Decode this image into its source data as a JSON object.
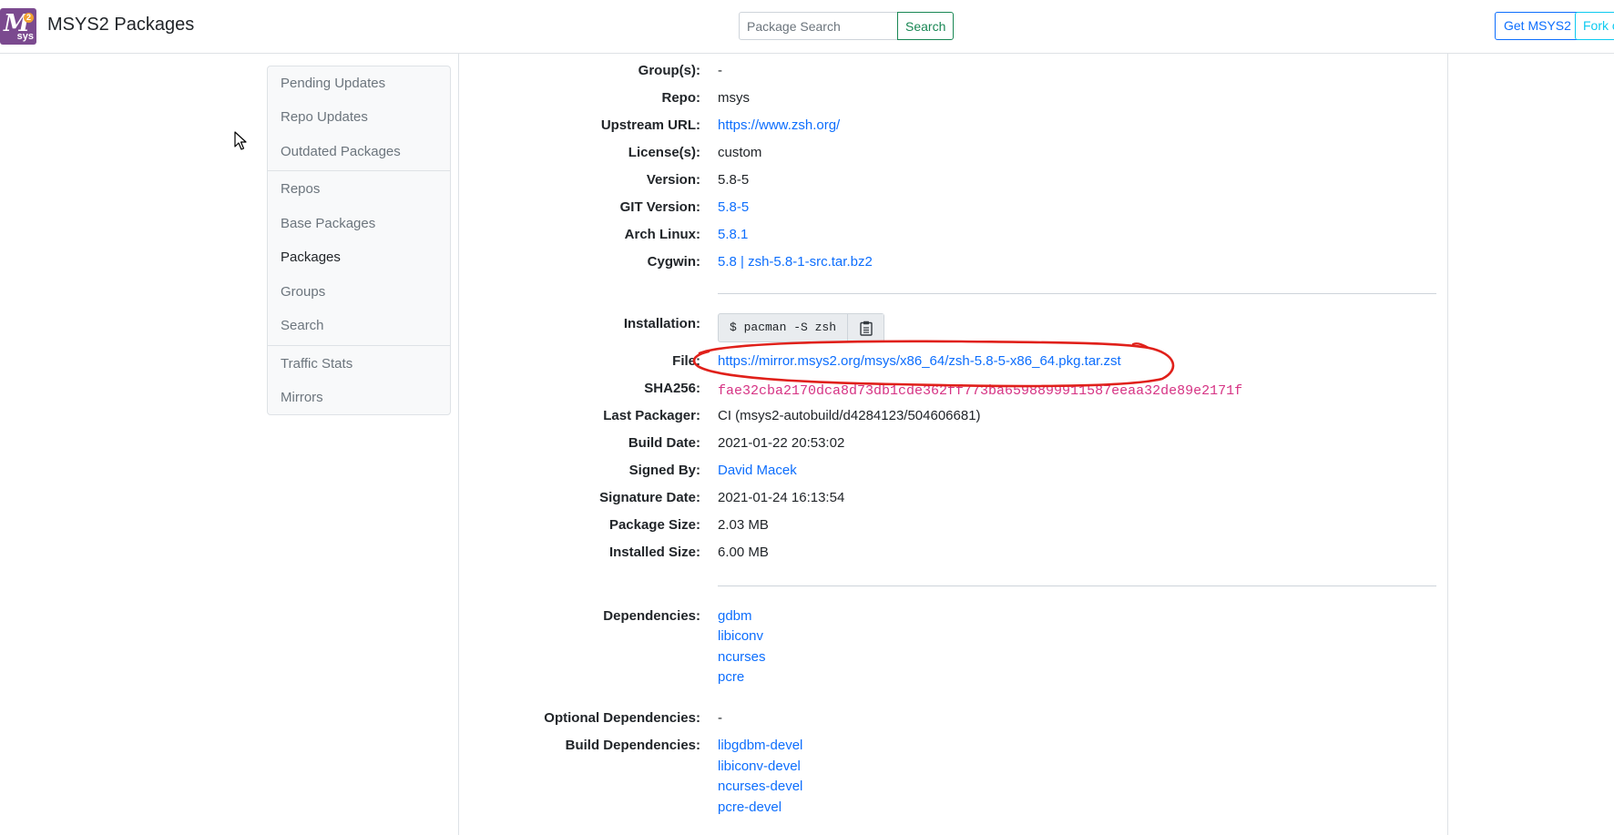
{
  "header": {
    "brand": "MSYS2 Packages",
    "logo_letter": "M",
    "logo_badge": "2",
    "logo_sub": "sys",
    "search_placeholder": "Package Search",
    "search_button": "Search",
    "get_button": "Get MSYS2",
    "fork_button": "Fork on GitHub"
  },
  "sidebar": {
    "items": [
      {
        "label": "Pending Updates"
      },
      {
        "label": "Repo Updates"
      },
      {
        "label": "Outdated Packages"
      },
      {
        "label": "Repos"
      },
      {
        "label": "Base Packages"
      },
      {
        "label": "Packages",
        "active": true
      },
      {
        "label": "Groups"
      },
      {
        "label": "Search"
      },
      {
        "label": "Traffic Stats"
      },
      {
        "label": "Mirrors"
      }
    ]
  },
  "details": {
    "groups": {
      "label": "Group(s):",
      "value": "-"
    },
    "repo": {
      "label": "Repo:",
      "value": "msys"
    },
    "upstream": {
      "label": "Upstream URL:",
      "value": "https://www.zsh.org/"
    },
    "license": {
      "label": "License(s):",
      "value": "custom"
    },
    "version": {
      "label": "Version:",
      "value": "5.8-5"
    },
    "git_version": {
      "label": "GIT Version:",
      "value": "5.8-5"
    },
    "arch": {
      "label": "Arch Linux:",
      "value": "5.8.1"
    },
    "cygwin": {
      "label": "Cygwin:",
      "value": "5.8 | zsh-5.8-1-src.tar.bz2"
    },
    "installation": {
      "label": "Installation:",
      "value": "$ pacman -S zsh"
    },
    "file": {
      "label": "File:",
      "value": "https://mirror.msys2.org/msys/x86_64/zsh-5.8-5-x86_64.pkg.tar.zst"
    },
    "sha256": {
      "label": "SHA256:",
      "value": "fae32cba2170dca8d73db1cde362ff773ba6598899911587eeaa32de89e2171f"
    },
    "packager": {
      "label": "Last Packager:",
      "value": "CI (msys2-autobuild/d4284123/504606681)"
    },
    "build_date": {
      "label": "Build Date:",
      "value": "2021-01-22 20:53:02"
    },
    "signed_by": {
      "label": "Signed By:",
      "value": "David Macek"
    },
    "sig_date": {
      "label": "Signature Date:",
      "value": "2021-01-24 16:13:54"
    },
    "pkg_size": {
      "label": "Package Size:",
      "value": "2.03 MB"
    },
    "inst_size": {
      "label": "Installed Size:",
      "value": "6.00 MB"
    }
  },
  "dependencies": {
    "label": "Dependencies:",
    "items": [
      "gdbm",
      "libiconv",
      "ncurses",
      "pcre"
    ]
  },
  "optional_dependencies": {
    "label": "Optional Dependencies:",
    "value": "-"
  },
  "build_dependencies": {
    "label": "Build Dependencies:",
    "items": [
      "libgdbm-devel",
      "libiconv-devel",
      "ncurses-devel",
      "pcre-devel"
    ]
  },
  "colors": {
    "annotation": "#e0201a",
    "link": "#0d6efd",
    "logo": "#7b4a8f"
  }
}
